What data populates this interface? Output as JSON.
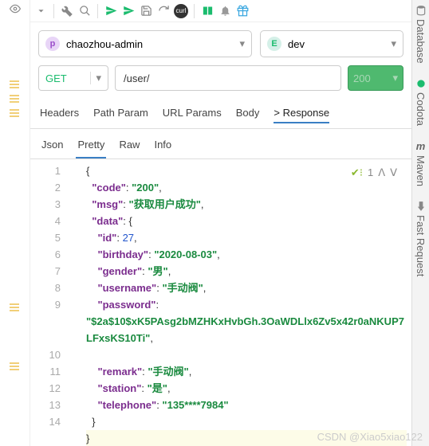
{
  "toolbar": {
    "curl": "curl"
  },
  "project": {
    "label": "chaozhou-admin"
  },
  "env": {
    "label": "dev"
  },
  "request": {
    "method": "GET",
    "url": "/user/",
    "status": "200"
  },
  "tabs1": {
    "headers": "Headers",
    "path": "Path Param",
    "url": "URL Params",
    "body": "Body",
    "response": "> Response"
  },
  "tabs2": {
    "json": "Json",
    "pretty": "Pretty",
    "raw": "Raw",
    "info": "Info"
  },
  "editor": {
    "check_count": "1"
  },
  "json_keys": {
    "code": "\"code\"",
    "msg": "\"msg\"",
    "data": "\"data\"",
    "id": "\"id\"",
    "birthday": "\"birthday\"",
    "gender": "\"gender\"",
    "username": "\"username\"",
    "password": "\"password\"",
    "remark": "\"remark\"",
    "station": "\"station\"",
    "telephone": "\"telephone\""
  },
  "json_vals": {
    "code": "\"200\"",
    "msg": "\"获取用户成功\"",
    "id": "27",
    "birthday": "\"2020-08-03\"",
    "gender": "\"男\"",
    "username": "\"手动阀\"",
    "password": "\"$2a$10$xK5PAsg2bMZHKxHvbGh.3OaWDLlx6Zv5x42r0aNKUP7LFxsKS10Ti\"",
    "remark": "\"手动阀\"",
    "station": "\"是\"",
    "telephone": "\"135****7984\""
  },
  "rail": {
    "database": "Database",
    "codota": "Codota",
    "maven": "Maven",
    "fast": "Fast Request"
  },
  "watermark": "CSDN @Xiao5xiao122",
  "lines": [
    "1",
    "2",
    "3",
    "4",
    "5",
    "6",
    "7",
    "8",
    "9",
    "",
    "",
    "10",
    "11",
    "12",
    "13",
    "14"
  ]
}
